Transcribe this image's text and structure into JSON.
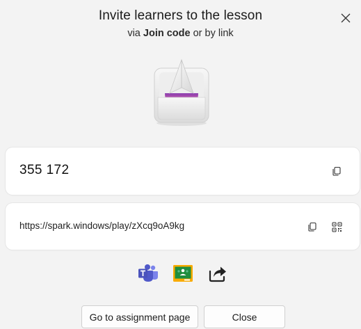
{
  "dialog": {
    "title": "Invite learners to the lesson",
    "subtitle_prefix": "via ",
    "subtitle_bold": "Join code",
    "subtitle_suffix": " or by link",
    "close_icon": "close-icon",
    "hero_icon": "paper-plane-tray-icon"
  },
  "join_code": {
    "value": "355 172",
    "copy_icon": "copy-icon"
  },
  "join_link": {
    "value": "https://spark.windows/play/zXcq9oA9kg",
    "copy_icon": "copy-icon",
    "qr_icon": "qr-code-icon"
  },
  "share_targets": [
    {
      "name": "Microsoft Teams",
      "icon": "teams-icon"
    },
    {
      "name": "Google Classroom",
      "icon": "google-classroom-icon"
    },
    {
      "name": "Share",
      "icon": "share-icon"
    }
  ],
  "buttons": {
    "go_to_assignment": "Go to assignment page",
    "close": "Close"
  },
  "colors": {
    "background": "#f3f3f3",
    "card": "#ffffff",
    "teams_purple": "#5059c9",
    "classroom_green": "#1e8e3e",
    "classroom_yellow": "#f9ab00"
  }
}
